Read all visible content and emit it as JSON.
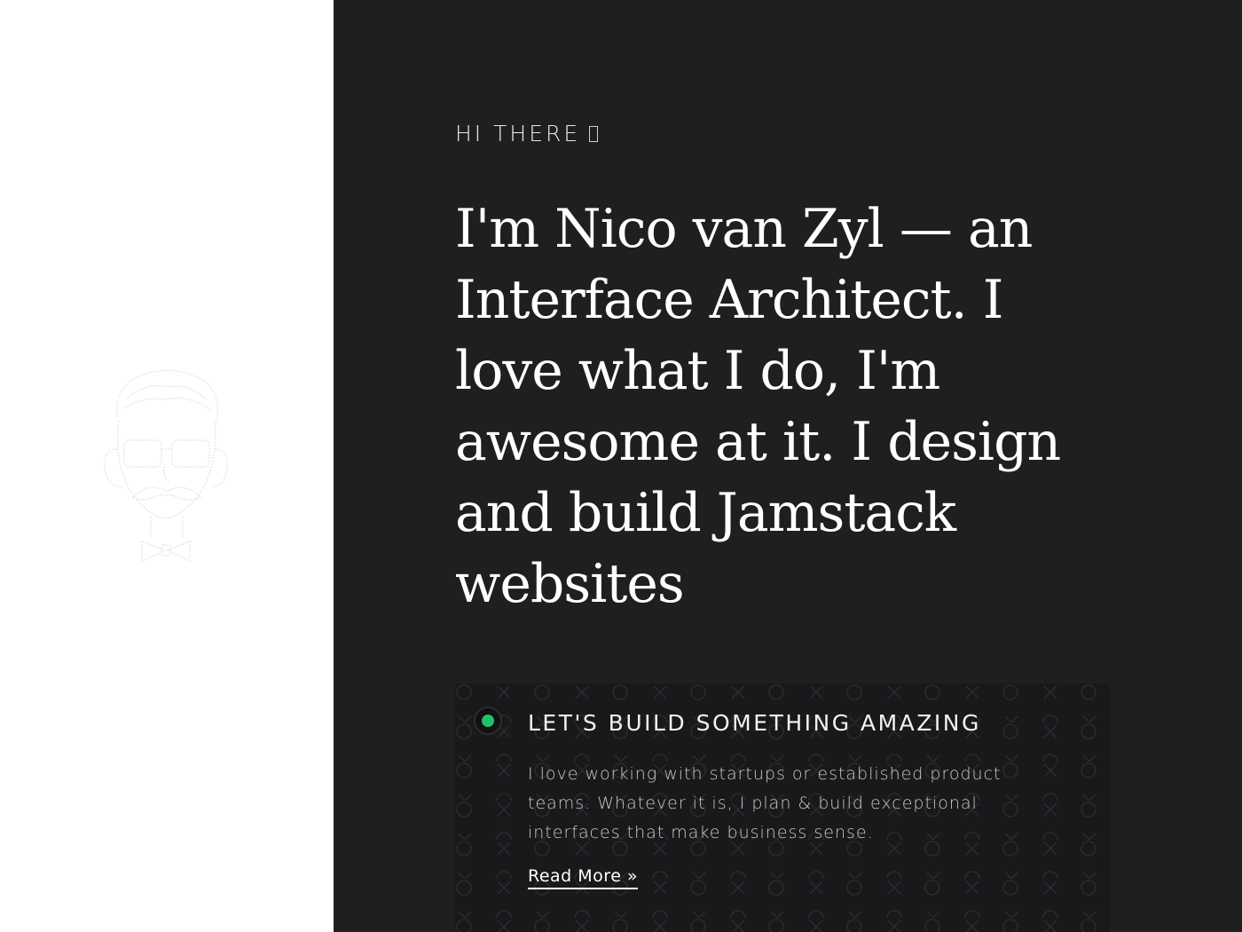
{
  "left_panel": {
    "avatar_icon": "mustache-man-avatar-icon"
  },
  "hero": {
    "greeting": "HI THERE",
    "greeting_glyph": "missing-emoji-glyph-icon",
    "headline": "I'm Nico van Zyl — an Interface Architect. I love what I do, I'm awesome at it. I design and build Jamstack websites"
  },
  "cta": {
    "status_icon": "green-status-dot-icon",
    "title": "LET'S BUILD SOMETHING AMAZING",
    "text": "I love working with startups or established product teams. Whatever it is, I plan & build exceptional interfaces that make business sense.",
    "read_more_label": "Read More »"
  },
  "colors": {
    "right_panel_bg": "#1f1f21",
    "card_bg": "#19191b",
    "accent_green": "#1fbf6b",
    "text_primary": "#ffffff"
  }
}
